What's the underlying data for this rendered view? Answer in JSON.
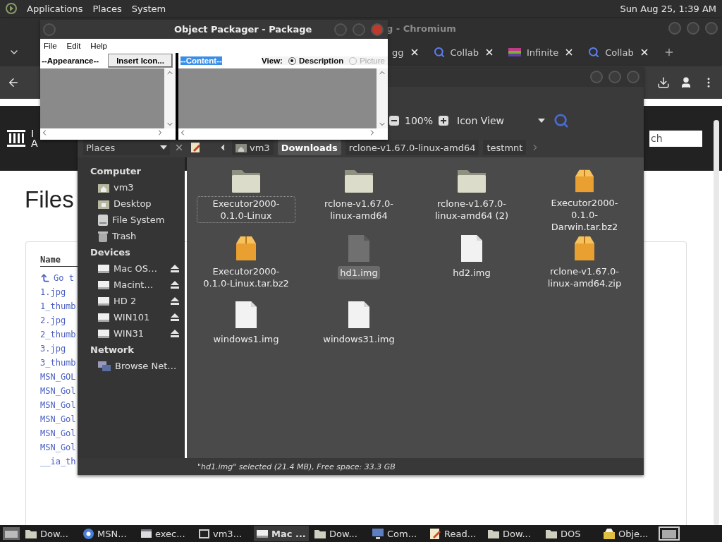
{
  "top_panel": {
    "menus": [
      "Applications",
      "Places",
      "System"
    ],
    "clock": "Sun Aug 25, 1:39 AM"
  },
  "browser": {
    "title": "g - Chromium",
    "tabs": [
      {
        "label": "gg",
        "selected": false
      },
      {
        "label": "Collab",
        "selected": false
      },
      {
        "label": "Infinite",
        "selected": false
      },
      {
        "label": "Collab",
        "selected": false
      }
    ],
    "page": {
      "logo_text": [
        "I",
        "A"
      ],
      "search": {
        "value": "ch"
      },
      "heading": "Files",
      "table": {
        "column": "Name",
        "rows": [
          {
            "label": "Go t",
            "kind": "parent"
          },
          {
            "label": "1.jpg",
            "kind": "file"
          },
          {
            "label": "1_thumb",
            "kind": "file"
          },
          {
            "label": "2.jpg",
            "kind": "file"
          },
          {
            "label": "2_thumb",
            "kind": "file"
          },
          {
            "label": "3.jpg",
            "kind": "file"
          },
          {
            "label": "3_thumb",
            "kind": "file"
          },
          {
            "label": "MSN_GOL",
            "kind": "file"
          },
          {
            "label": "MSN_Gol",
            "kind": "file"
          },
          {
            "label": "MSN_Gol",
            "kind": "file"
          },
          {
            "label": "MSN_Gol",
            "kind": "file"
          },
          {
            "label": "MSN_Gol",
            "kind": "file"
          },
          {
            "label": "MSN_Gol",
            "kind": "file"
          },
          {
            "label": "__ia_th",
            "kind": "file"
          }
        ]
      }
    }
  },
  "file_manager": {
    "toolbar": {
      "zoom": "100%",
      "view": "Icon View"
    },
    "sidebar": {
      "title": "Places",
      "sections": [
        {
          "heading": "Computer",
          "items": [
            {
              "label": "vm3",
              "kind": "place"
            },
            {
              "label": "Desktop",
              "kind": "place"
            },
            {
              "label": "File System",
              "kind": "place"
            },
            {
              "label": "Trash",
              "kind": "place"
            }
          ]
        },
        {
          "heading": "Devices",
          "items": [
            {
              "label": "Mac OS…",
              "kind": "device"
            },
            {
              "label": "Macint…",
              "kind": "device"
            },
            {
              "label": "HD 2",
              "kind": "device"
            },
            {
              "label": "WIN101",
              "kind": "device"
            },
            {
              "label": "WIN31",
              "kind": "device"
            }
          ]
        },
        {
          "heading": "Network",
          "items": [
            {
              "label": "Browse Net…",
              "kind": "place"
            }
          ]
        }
      ]
    },
    "path": [
      {
        "label": "vm3",
        "selected": false
      },
      {
        "label": "Downloads",
        "selected": true
      },
      {
        "label": "rclone-v1.67.0-linux-amd64",
        "selected": false
      },
      {
        "label": "testmnt",
        "selected": false
      }
    ],
    "files": [
      {
        "name": "Executor2000-0.1.0-Linux",
        "kind": "folder",
        "selected": false,
        "focused": true
      },
      {
        "name": "rclone-v1.67.0-linux-amd64",
        "kind": "folder",
        "selected": false,
        "focused": false
      },
      {
        "name": "rclone-v1.67.0-linux-amd64 (2)",
        "kind": "folder",
        "selected": false,
        "focused": false
      },
      {
        "name": "Executor2000-0.1.0-Darwin.tar.bz2",
        "kind": "archive",
        "selected": false,
        "focused": false
      },
      {
        "name": "Executor2000-0.1.0-Linux.tar.bz2",
        "kind": "archive",
        "selected": false,
        "focused": false
      },
      {
        "name": "hd1.img",
        "kind": "file",
        "selected": true,
        "focused": false
      },
      {
        "name": "hd2.img",
        "kind": "file",
        "selected": false,
        "focused": false
      },
      {
        "name": "rclone-v1.67.0-linux-amd64.zip",
        "kind": "archive",
        "selected": false,
        "focused": false
      },
      {
        "name": "windows1.img",
        "kind": "file",
        "selected": false,
        "focused": false
      },
      {
        "name": "windows31.img",
        "kind": "file",
        "selected": false,
        "focused": false
      }
    ],
    "status": "\"hd1.img\" selected (21.4 MB), Free space: 33.3 GB"
  },
  "packager": {
    "title": "Object Packager - Package",
    "menus": [
      "File",
      "Edit",
      "Help"
    ],
    "appearance_label": "--Appearance--",
    "insert_button": "Insert Icon...",
    "content_label": "--Content--",
    "view_label": "View:",
    "view_options": [
      {
        "label": "Description",
        "selected": true,
        "disabled": false
      },
      {
        "label": "Picture",
        "selected": false,
        "disabled": true
      }
    ]
  },
  "taskbar": {
    "items": [
      {
        "label": "Dow...",
        "selected": false
      },
      {
        "label": "MSN...",
        "selected": false
      },
      {
        "label": "exec...",
        "selected": false
      },
      {
        "label": "vm3...",
        "selected": false
      },
      {
        "label": "Mac ...",
        "selected": true
      },
      {
        "label": "Dow...",
        "selected": false
      },
      {
        "label": "Com...",
        "selected": false
      },
      {
        "label": "Read...",
        "selected": false
      },
      {
        "label": "Dow...",
        "selected": false
      },
      {
        "label": "DOS",
        "selected": false
      },
      {
        "label": "Obje...",
        "selected": false
      }
    ]
  }
}
